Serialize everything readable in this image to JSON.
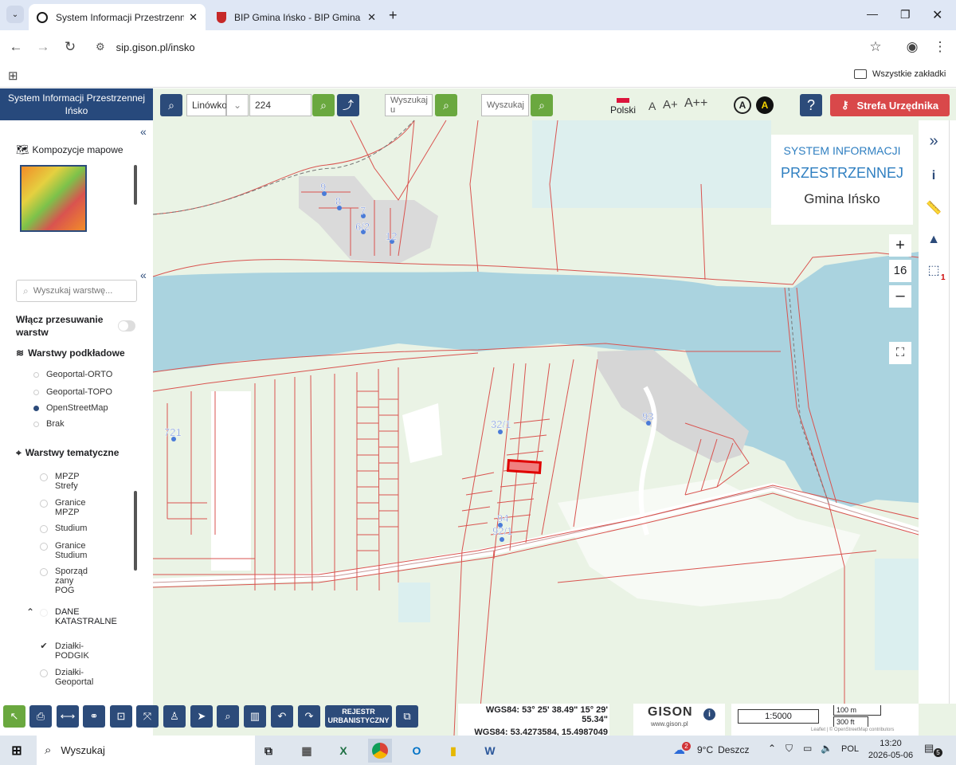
{
  "browser": {
    "tabs": [
      {
        "title": "System Informacji Przestrzenne"
      },
      {
        "title": "BIP Gmina Ińsko - BIP Gmina Iń"
      }
    ],
    "url": "sip.gison.pl/insko",
    "bookmarks_label": "Wszystkie zakładki"
  },
  "app": {
    "title_line1": "System Informacji Przestrzennej",
    "title_line2": "Ińsko",
    "search_parcel": {
      "obreb": "Linówko",
      "number": "224"
    },
    "search1_placeholder": "Wyszukaj u",
    "search2_placeholder": "Wyszukaj",
    "language": "Polski",
    "font_sizes": [
      "A",
      "A+",
      "A++"
    ],
    "contrast": [
      "A",
      "A"
    ],
    "help": "?",
    "strefa_button": "Strefa Urzędnika",
    "brand": {
      "line1": "SYSTEM INFORMACJI",
      "line2": "PRZESTRZENNEJ",
      "line3": "Gmina Ińsko"
    },
    "zoom_level": "16",
    "notification_count": "1"
  },
  "left_panel": {
    "kompozycje_label": "Kompozycje mapowe",
    "search_layers_placeholder": "Wyszukaj warstwę...",
    "toggle_label": "Włącz przesuwanie warstw",
    "base_layers_label": "Warstwy podkładowe",
    "base_layers": [
      {
        "label": "Geoportal-ORTO",
        "selected": false
      },
      {
        "label": "Geoportal-TOPO",
        "selected": false
      },
      {
        "label": "OpenStreetMap",
        "selected": true
      },
      {
        "label": "Brak",
        "selected": false
      }
    ],
    "thematic_label": "Warstwy tematyczne",
    "thematic_items": [
      {
        "label": "MPZP Strefy",
        "checked": false
      },
      {
        "label": "Granice MPZP",
        "checked": false
      },
      {
        "label": "Studium",
        "checked": false
      },
      {
        "label": "Granice Studium",
        "checked": false
      },
      {
        "label": "Sporząd zany POG",
        "checked": false
      }
    ],
    "group_label": "DANE KATASTRALNE",
    "group_items": [
      {
        "label": "Działki-PODGIK",
        "checked": true
      },
      {
        "label": "Działki-Geoportal",
        "checked": false
      }
    ]
  },
  "map_labels": {
    "parcels": [
      "9",
      "8",
      "7",
      "6/2",
      "12",
      "721",
      "32/1",
      "94",
      "92/1",
      "93"
    ]
  },
  "bottom": {
    "rejestr": "REJESTR URBANISTYCZNY",
    "coords_dms_label": "WGS84:",
    "coords_dms": "53° 25' 38.49\" 15° 29' 55.34\"",
    "coords_dec_label": "WGS84:",
    "coords_dec": "53.4273584, 15.4987049",
    "gison_logo": "GISON",
    "gison_url": "www.gison.pl",
    "scale": "1:5000",
    "scale_m": "100 m",
    "scale_ft": "300 ft",
    "attribution": "Leaflet | © OpenStreetMap contributors"
  },
  "taskbar": {
    "search": "Wyszukaj",
    "weather_temp": "9°C",
    "weather_desc": "Deszcz",
    "weather_badge": "2",
    "lang": "POL",
    "time": "13:20",
    "date": "2026-05-06",
    "notif_count": "5"
  }
}
